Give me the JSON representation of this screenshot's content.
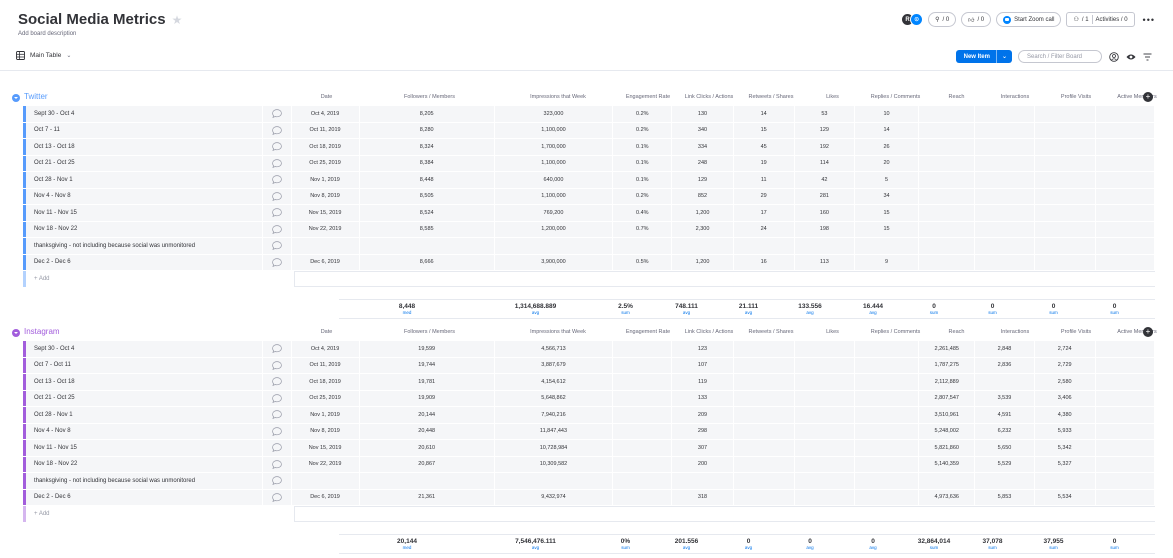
{
  "board": {
    "title": "Social Media Metrics",
    "description": "Add board description",
    "view": "Main Table"
  },
  "topbar": {
    "avatar_letter": "R",
    "search_count": "/ 0",
    "likes_count": "/ 0",
    "zoom_label": "Start Zoom call",
    "members_count": "/ 1",
    "activities_label": "Activities / 0",
    "more_label": "•••"
  },
  "toolbar": {
    "new_item_label": "New Item",
    "search_placeholder": "Search / Filter Board"
  },
  "columns": [
    "Date",
    "Followers / Members",
    "Impressions that Week",
    "Engagement Rate",
    "Link Clicks / Actions",
    "Retweets / Shares",
    "Likes",
    "Replies / Comments",
    "Reach",
    "Interactions",
    "Profile Visits",
    "Active Members"
  ],
  "add_label": "+ Add",
  "groups": [
    {
      "name": "Twitter",
      "color": "#579bfc",
      "rows": [
        {
          "name": "Sept 30 - Oct 4",
          "cells": [
            "Oct 4, 2019",
            "8,205",
            "323,000",
            "0.2%",
            "130",
            "14",
            "53",
            "10",
            "",
            "",
            "",
            ""
          ]
        },
        {
          "name": "Oct 7 - 11",
          "cells": [
            "Oct 11, 2019",
            "8,280",
            "1,100,000",
            "0.2%",
            "340",
            "15",
            "129",
            "14",
            "",
            "",
            "",
            ""
          ]
        },
        {
          "name": "Oct 13 - Oct 18",
          "cells": [
            "Oct 18, 2019",
            "8,324",
            "1,700,000",
            "0.1%",
            "334",
            "45",
            "192",
            "26",
            "",
            "",
            "",
            ""
          ]
        },
        {
          "name": "Oct 21 - Oct 25",
          "cells": [
            "Oct 25, 2019",
            "8,384",
            "1,100,000",
            "0.1%",
            "248",
            "19",
            "114",
            "20",
            "",
            "",
            "",
            ""
          ]
        },
        {
          "name": "Oct 28 - Nov 1",
          "cells": [
            "Nov 1, 2019",
            "8,448",
            "640,000",
            "0.1%",
            "129",
            "11",
            "42",
            "5",
            "",
            "",
            "",
            ""
          ]
        },
        {
          "name": "Nov 4 - Nov 8",
          "cells": [
            "Nov 8, 2019",
            "8,505",
            "1,100,000",
            "0.2%",
            "852",
            "29",
            "281",
            "34",
            "",
            "",
            "",
            ""
          ]
        },
        {
          "name": "Nov 11 - Nov 15",
          "cells": [
            "Nov 15, 2019",
            "8,524",
            "769,200",
            "0.4%",
            "1,200",
            "17",
            "160",
            "15",
            "",
            "",
            "",
            ""
          ]
        },
        {
          "name": "Nov 18 - Nov 22",
          "cells": [
            "Nov 22, 2019",
            "8,585",
            "1,200,000",
            "0.7%",
            "2,300",
            "24",
            "198",
            "15",
            "",
            "",
            "",
            ""
          ]
        },
        {
          "name": "thanksgiving - not including because social was unmonitored",
          "cells": [
            "",
            "",
            "",
            "",
            "",
            "",
            "",
            "",
            "",
            "",
            "",
            ""
          ]
        },
        {
          "name": "Dec 2 - Dec 6",
          "cells": [
            "Dec 6, 2019",
            "8,666",
            "3,900,000",
            "0.5%",
            "1,200",
            "16",
            "113",
            "9",
            "",
            "",
            "",
            ""
          ]
        }
      ],
      "summary": [
        {
          "value": "8,448",
          "unit": "med"
        },
        {
          "value": "1,314,688.889",
          "unit": "avg"
        },
        {
          "value": "2.5%",
          "unit": "sum"
        },
        {
          "value": "748.111",
          "unit": "avg"
        },
        {
          "value": "21.111",
          "unit": "avg"
        },
        {
          "value": "133.556",
          "unit": "avg"
        },
        {
          "value": "16.444",
          "unit": "avg"
        },
        {
          "value": "0",
          "unit": "sum"
        },
        {
          "value": "0",
          "unit": "sum"
        },
        {
          "value": "0",
          "unit": "sum"
        },
        {
          "value": "0",
          "unit": "sum"
        }
      ]
    },
    {
      "name": "Instagram",
      "color": "#a25ddc",
      "rows": [
        {
          "name": "Sept 30 - Oct 4",
          "cells": [
            "Oct 4, 2019",
            "19,599",
            "4,566,713",
            "",
            "123",
            "",
            "",
            "",
            "2,261,485",
            "2,848",
            "2,724",
            ""
          ]
        },
        {
          "name": "Oct 7 - Oct 11",
          "cells": [
            "Oct 11, 2019",
            "19,744",
            "3,887,679",
            "",
            "107",
            "",
            "",
            "",
            "1,787,275",
            "2,836",
            "2,729",
            ""
          ]
        },
        {
          "name": "Oct 13 - Oct 18",
          "cells": [
            "Oct 18, 2019",
            "19,781",
            "4,154,612",
            "",
            "119",
            "",
            "",
            "",
            "2,112,889",
            "",
            "2,580",
            ""
          ]
        },
        {
          "name": "Oct 21 - Oct 25",
          "cells": [
            "Oct 25, 2019",
            "19,909",
            "5,648,862",
            "",
            "133",
            "",
            "",
            "",
            "2,807,547",
            "3,539",
            "3,406",
            ""
          ]
        },
        {
          "name": "Oct 28 - Nov 1",
          "cells": [
            "Nov 1, 2019",
            "20,144",
            "7,940,216",
            "",
            "209",
            "",
            "",
            "",
            "3,510,961",
            "4,591",
            "4,380",
            ""
          ]
        },
        {
          "name": "Nov 4 - Nov 8",
          "cells": [
            "Nov 8, 2019",
            "20,448",
            "11,847,443",
            "",
            "298",
            "",
            "",
            "",
            "5,248,002",
            "6,232",
            "5,933",
            ""
          ]
        },
        {
          "name": "Nov 11 - Nov 15",
          "cells": [
            "Nov 15, 2019",
            "20,610",
            "10,728,984",
            "",
            "307",
            "",
            "",
            "",
            "5,821,860",
            "5,650",
            "5,342",
            ""
          ]
        },
        {
          "name": "Nov 18 - Nov 22",
          "cells": [
            "Nov 22, 2019",
            "20,867",
            "10,309,582",
            "",
            "200",
            "",
            "",
            "",
            "5,140,359",
            "5,529",
            "5,327",
            ""
          ]
        },
        {
          "name": "thanksgiving - not including because social was unmonitored",
          "cells": [
            "",
            "",
            "",
            "",
            "",
            "",
            "",
            "",
            "",
            "",
            "",
            ""
          ]
        },
        {
          "name": "Dec 2 - Dec 6",
          "cells": [
            "Dec 6, 2019",
            "21,361",
            "9,432,974",
            "",
            "318",
            "",
            "",
            "",
            "4,973,636",
            "5,853",
            "5,534",
            ""
          ]
        }
      ],
      "summary": [
        {
          "value": "20,144",
          "unit": "med"
        },
        {
          "value": "7,546,476.111",
          "unit": "avg"
        },
        {
          "value": "0%",
          "unit": "sum"
        },
        {
          "value": "201.556",
          "unit": "avg"
        },
        {
          "value": "0",
          "unit": "avg"
        },
        {
          "value": "0",
          "unit": "avg"
        },
        {
          "value": "0",
          "unit": "avg"
        },
        {
          "value": "32,864,014",
          "unit": "sum"
        },
        {
          "value": "37,078",
          "unit": "sum"
        },
        {
          "value": "37,955",
          "unit": "sum"
        },
        {
          "value": "0",
          "unit": "sum"
        }
      ]
    }
  ]
}
